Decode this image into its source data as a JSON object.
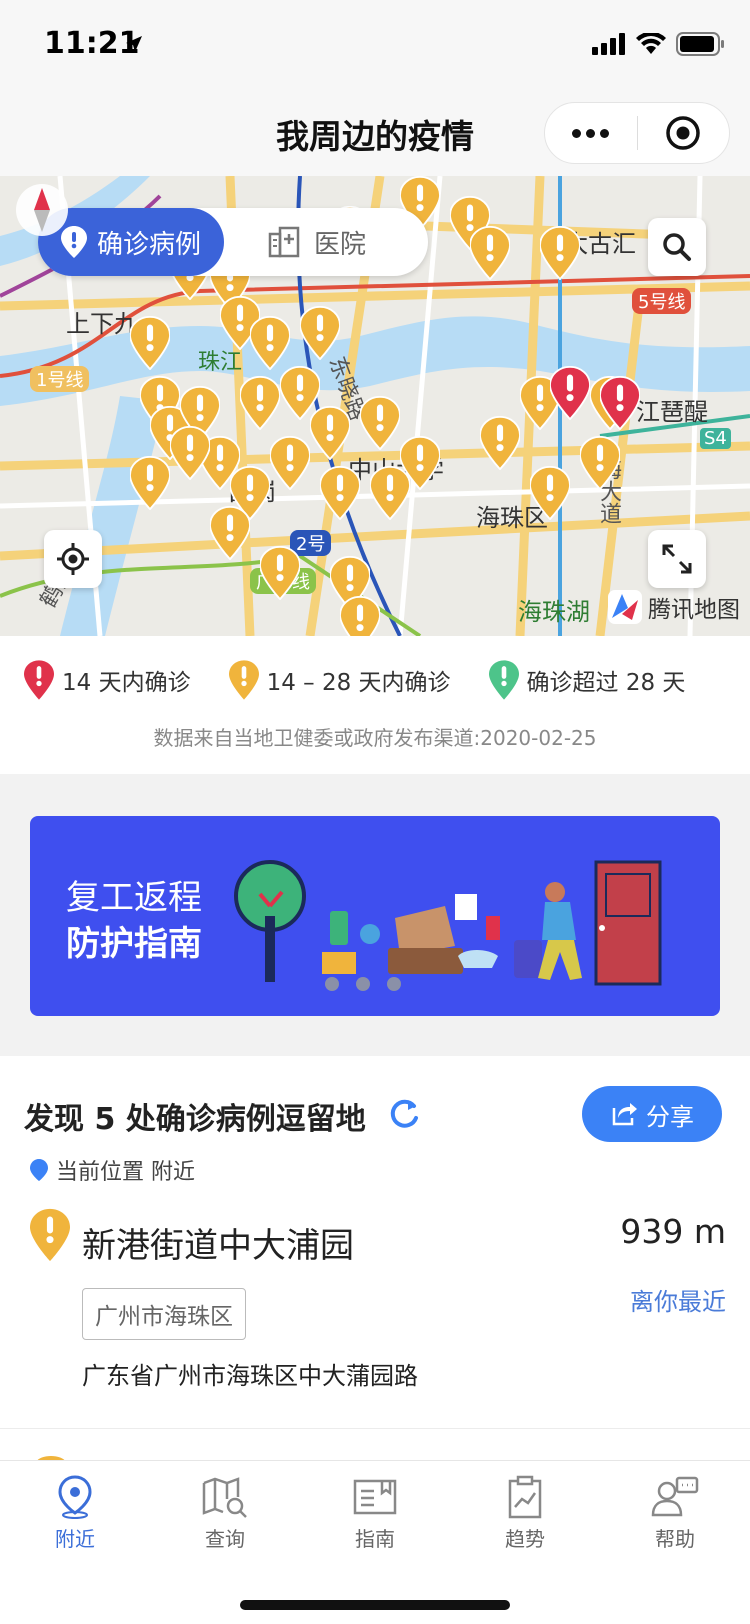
{
  "status": {
    "time": "11:21"
  },
  "nav": {
    "title": "我周边的疫情"
  },
  "map": {
    "tabs": [
      {
        "label": "确诊病例",
        "active": true
      },
      {
        "label": "医院",
        "active": false
      }
    ],
    "labels": {
      "shangxiajiu": "上下九",
      "taiguhui": "太古汇",
      "line5": "5号线",
      "line1": "1号线",
      "zhongshan_univ": "中山大学",
      "haizhu_district": "海珠区",
      "jiangtaixing": "江琶醍",
      "changgang": "昌岗",
      "line2": "2号",
      "guangfo": "广佛线",
      "haizhu_lake": "海珠湖",
      "s4": "S4",
      "zhuhai": "珠江",
      "dongxiao": "东晓路",
      "hedong": "鹤洞路",
      "haida": "海大道"
    },
    "brand": "腾讯地图"
  },
  "legend": {
    "items": [
      {
        "label": "14 天内确诊",
        "color": "#e0324b"
      },
      {
        "label": "14 – 28 天内确诊",
        "color": "#f0b43c"
      },
      {
        "label": "确诊超过 28 天",
        "color": "#4dc48a"
      }
    ],
    "source": "数据来自当地卫健委或政府发布渠道:2020-02-25"
  },
  "banner": {
    "line1": "复工返程",
    "line2": "防护指南"
  },
  "list": {
    "title": "发现 5 处确诊病例逗留地",
    "share_label": "分享",
    "location": "当前位置 附近",
    "items": [
      {
        "name": "新港街道中大浦园",
        "distance": "939 m",
        "nearest": "离你最近",
        "district": "广州市海珠区",
        "address": "广东省广州市海珠区中大蒲园路"
      }
    ]
  },
  "tabbar": {
    "items": [
      {
        "label": "附近",
        "icon": "location-icon",
        "active": true
      },
      {
        "label": "查询",
        "icon": "map-search-icon",
        "active": false
      },
      {
        "label": "指南",
        "icon": "book-icon",
        "active": false
      },
      {
        "label": "趋势",
        "icon": "trend-clipboard-icon",
        "active": false
      },
      {
        "label": "帮助",
        "icon": "help-chat-icon",
        "active": false
      }
    ]
  },
  "colors": {
    "primary": "#3b63d9",
    "pin_yellow": "#f0b43c",
    "pin_red": "#e0324b",
    "pin_green": "#4dc48a",
    "banner_bg": "#3f4fef",
    "share_bg": "#3b82f6"
  }
}
